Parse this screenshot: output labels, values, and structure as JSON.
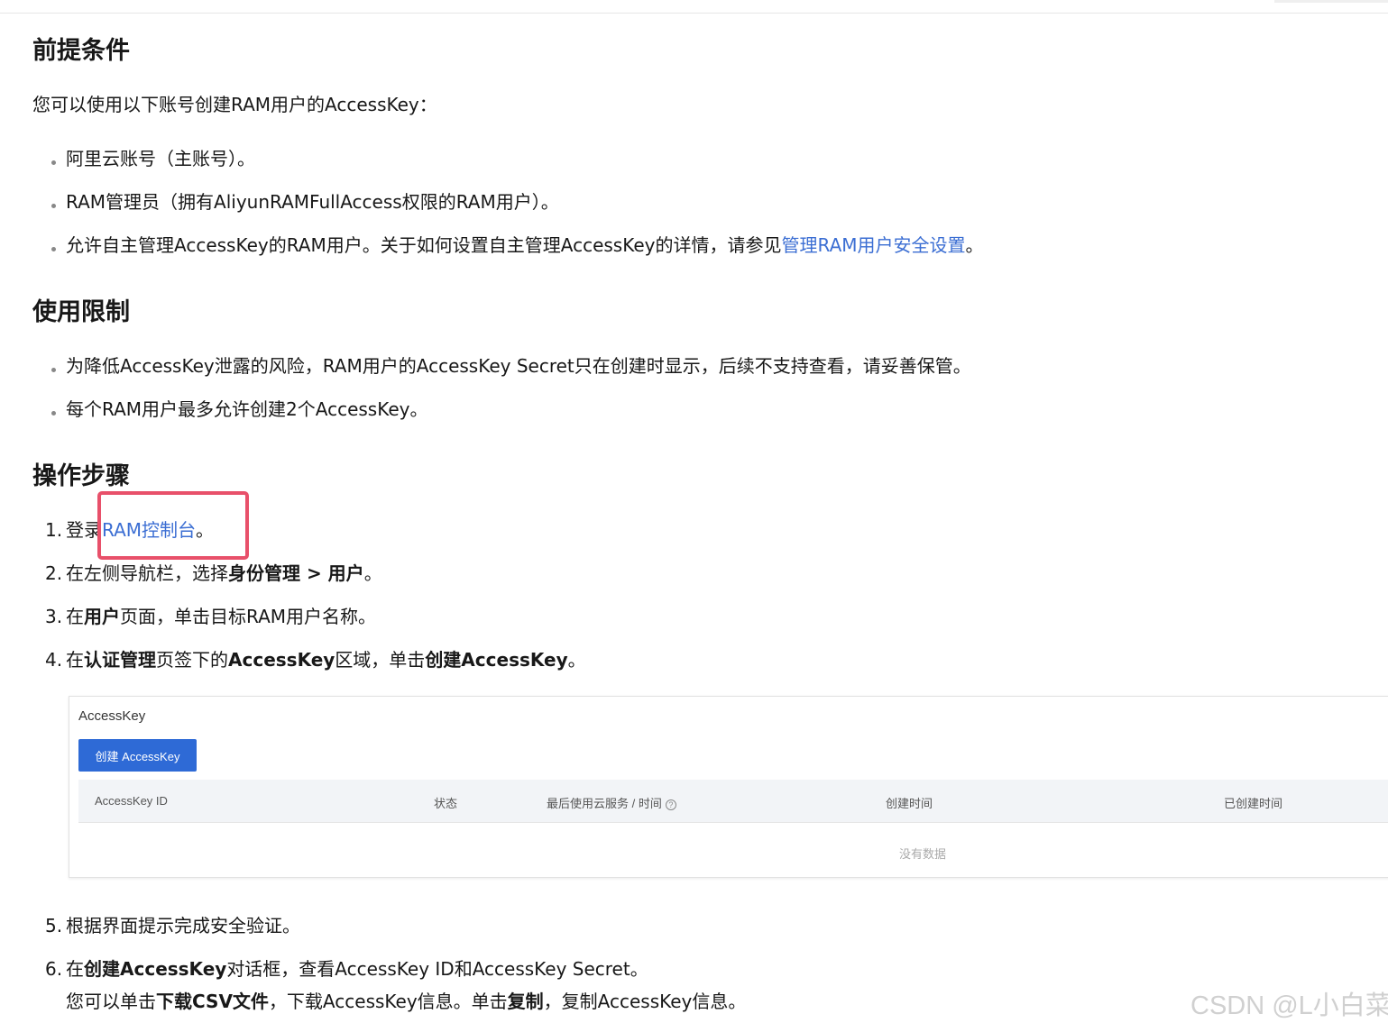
{
  "sections": {
    "prereq": {
      "title": "前提条件",
      "intro": "您可以使用以下账号创建RAM用户的AccessKey：",
      "items": [
        "阿里云账号（主账号）。",
        "RAM管理员（拥有AliyunRAMFullAccess权限的RAM用户）。"
      ],
      "item3_pre": "允许自主管理AccessKey的RAM用户。关于如何设置自主管理AccessKey的详情，请参见",
      "item3_link": "管理RAM用户安全设置",
      "item3_post": "。"
    },
    "limits": {
      "title": "使用限制",
      "items": [
        "为降低AccessKey泄露的风险，RAM用户的AccessKey Secret只在创建时显示，后续不支持查看，请妥善保管。",
        "每个RAM用户最多允许创建2个AccessKey。"
      ]
    },
    "steps": {
      "title": "操作步骤",
      "numbers": [
        "1.",
        "2.",
        "3.",
        "4.",
        "5.",
        "6."
      ],
      "s1_pre": "登录",
      "s1_link": "RAM控制台",
      "s1_post": "。",
      "s2_pre": "在左侧导航栏，选择",
      "s2_bold": "身份管理 > 用户",
      "s2_post": "。",
      "s3_pre": "在",
      "s3_bold": "用户",
      "s3_post": "页面，单击目标RAM用户名称。",
      "s4_pre": "在",
      "s4_bold1": "认证管理",
      "s4_mid1": "页签下的",
      "s4_bold2": "AccessKey",
      "s4_mid2": "区域，单击",
      "s4_bold3": "创建AccessKey",
      "s4_post": "。",
      "s5": "根据界面提示完成安全验证。",
      "s6_pre": "在",
      "s6_bold": "创建AccessKey",
      "s6_post": "对话框，查看AccessKey ID和AccessKey Secret。",
      "s6b_pre": "您可以单击",
      "s6b_bold1": "下载CSV文件",
      "s6b_mid": "，下载AccessKey信息。单击",
      "s6b_bold2": "复制",
      "s6b_post": "，复制AccessKey信息。"
    }
  },
  "screenshot": {
    "title": "AccessKey",
    "button": "创建 AccessKey",
    "columns": [
      "AccessKey ID",
      "状态",
      "最后使用云服务 / 时间",
      "创建时间",
      "已创建时间"
    ],
    "help_icon": "?",
    "empty": "没有数据"
  },
  "watermark": "CSDN @L小白菜",
  "colors": {
    "link": "#3b6ed3",
    "highlight_box": "#e8506a",
    "primary_button": "#2e6ad6"
  }
}
